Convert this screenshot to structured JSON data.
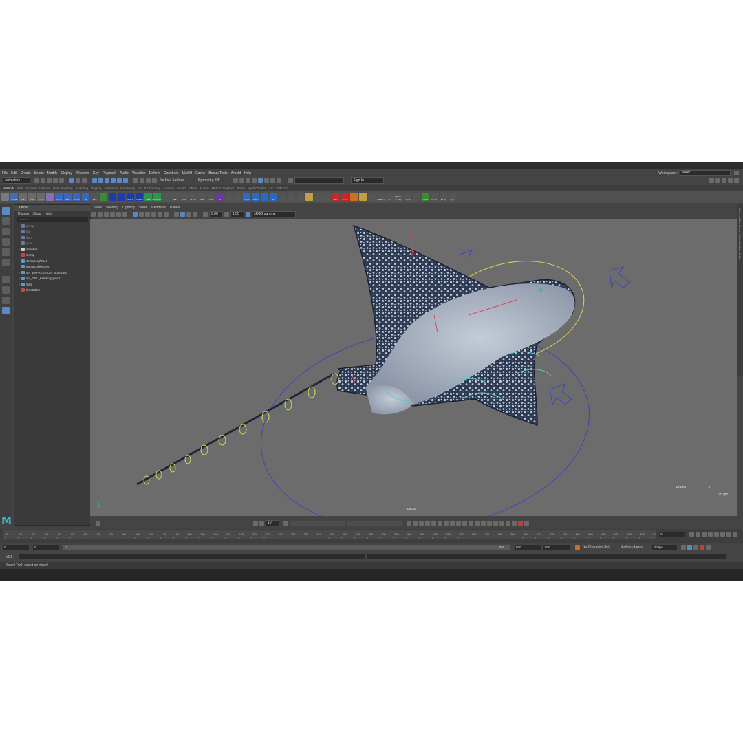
{
  "menus": [
    "File",
    "Edit",
    "Create",
    "Select",
    "Modify",
    "Display",
    "Windows",
    "Key",
    "Playback",
    "Audio",
    "Visualize",
    "Deform",
    "Constrain",
    "MASH",
    "Cache",
    "Bonus Tools",
    "Arnold",
    "Help"
  ],
  "workspace": {
    "label": "Workspace :",
    "value": "Mike*"
  },
  "status": {
    "mode": "Animation",
    "live_surface": "No Live Surface",
    "symmetry": "Symmetry: Off",
    "sign_in": "Sign In"
  },
  "shelf_tabs": [
    "MyWork",
    "Rich",
    "Curves / Surfaces",
    "Poly Modeling",
    "Sculpting",
    "Rigging",
    "Animation",
    "Rendering",
    "FX",
    "FX Caching",
    "Custom",
    "Arnold",
    "Bifrost",
    "MASH",
    "Motion Graphics",
    "XGen",
    "ngSkinTools2",
    "AS",
    "TURTLE"
  ],
  "shelf_icons": [
    {
      "label": "",
      "color": "#7a7a7a"
    },
    {
      "label": "GLOB",
      "color": "#3d6fa8"
    },
    {
      "label": "RT",
      "color": "#6a6a6a"
    },
    {
      "label": "CP",
      "color": "#6a6a6a"
    },
    {
      "label": "sweet",
      "color": "#6a6a6a"
    },
    {
      "label": "",
      "color": "#8a6fb0"
    },
    {
      "label": "Orient",
      "color": "#3966c0"
    },
    {
      "label": "CTRLs",
      "color": "#3966c0"
    },
    {
      "label": "CV>CV",
      "color": "#3966c0"
    },
    {
      "label": "JS",
      "color": "#3966c0"
    },
    {
      "label": "RSc",
      "color": "#555"
    },
    {
      "label": "",
      "color": "#3a8a3a"
    },
    {
      "label": "",
      "color": "#1b3da8"
    },
    {
      "label": "",
      "color": "#1b3da8"
    },
    {
      "label": "P-R-S",
      "color": "#1b3da8"
    },
    {
      "label": "CONST",
      "color": "#1b3da8"
    },
    {
      "label": "SBS",
      "color": "#2a9a4a"
    },
    {
      "label": "Replicates",
      "color": "#2a9a4a"
    },
    {
      "label": "",
      "color": "#555"
    },
    {
      "label": "BT",
      "color": "#555"
    },
    {
      "label": "NR",
      "color": "#555"
    },
    {
      "label": "M.T.R",
      "color": "#555"
    },
    {
      "label": "MAT",
      "color": "#555"
    },
    {
      "label": "Ctrlt",
      "color": "#555"
    },
    {
      "label": "JS",
      "color": "#6a3a9a"
    },
    {
      "label": "",
      "color": "#555"
    },
    {
      "label": "",
      "color": "#555"
    },
    {
      "label": "Graph",
      "color": "#2a6ac0"
    },
    {
      "label": "CySel",
      "color": "#2a6ac0"
    },
    {
      "label": "",
      "color": "#2a6ac0"
    },
    {
      "label": "SE",
      "color": "#2a6ac0"
    },
    {
      "label": "",
      "color": "#555"
    },
    {
      "label": "",
      "color": "#555"
    },
    {
      "label": "",
      "color": "#555"
    },
    {
      "label": "",
      "color": "#c0a040"
    },
    {
      "label": "",
      "color": "#555"
    },
    {
      "label": "",
      "color": "#555"
    },
    {
      "label": "Bus",
      "color": "#c02a2a"
    },
    {
      "label": "Curvy",
      "color": "#c02a2a"
    },
    {
      "label": "",
      "color": "#d07020"
    },
    {
      "label": "",
      "color": "#c0a040"
    },
    {
      "label": "",
      "color": "#555"
    },
    {
      "label": "CR/Seq",
      "color": "#555"
    },
    {
      "label": "Sel",
      "color": "#555"
    },
    {
      "label": "Ribbon ev+dupl",
      "color": "#555"
    },
    {
      "label": "export",
      "color": "#555"
    },
    {
      "label": "",
      "color": "#555"
    },
    {
      "label": "EasiRef",
      "color": "#3a8a3a"
    },
    {
      "label": "Ejects",
      "color": "#555"
    },
    {
      "label": "Bt+ej",
      "color": "#555"
    },
    {
      "label": "Dyn",
      "color": "#555"
    }
  ],
  "outliner": {
    "title": "Outliner",
    "menu": [
      "Display",
      "Show",
      "Help"
    ],
    "search_placeholder": "Search...",
    "items": [
      {
        "label": "persp",
        "dim": true,
        "expand": ""
      },
      {
        "label": "top",
        "dim": true,
        "expand": ""
      },
      {
        "label": "front",
        "dim": true,
        "expand": ""
      },
      {
        "label": "side",
        "dim": true,
        "expand": ""
      },
      {
        "label": "animBot",
        "dim": false,
        "expand": "+"
      },
      {
        "label": "Group",
        "dim": false,
        "expand": "+"
      },
      {
        "label": "defaultLightSet",
        "dim": false,
        "expand": ""
      },
      {
        "label": "defaultObjectSet",
        "dim": false,
        "expand": ""
      },
      {
        "label": "set_EXPRESSION_Spiracles",
        "dim": false,
        "expand": "+"
      },
      {
        "label": "set_GBL_hidePolygons1",
        "dim": false,
        "expand": "+"
      },
      {
        "label": "Sets",
        "dim": false,
        "expand": "+"
      },
      {
        "label": "timeEditor",
        "dim": false,
        "expand": ""
      }
    ]
  },
  "viewport": {
    "menu": [
      "View",
      "Shading",
      "Lighting",
      "Show",
      "Renderer",
      "Panels"
    ],
    "exposure": "0.00",
    "gamma": "1.00",
    "color_space": "sRGB gamma",
    "camera": "persp",
    "frame_label": "Frame:",
    "frame_value": "0",
    "fps": "6.8 fps"
  },
  "side_panel": "Channel Box / Layer Editor   Attribute Editor",
  "bottom_toolbar": {
    "value": "10",
    "small1": "0.5"
  },
  "timeline": {
    "ticks": [
      0,
      10,
      20,
      30,
      40,
      50,
      60,
      70,
      80,
      90,
      100,
      110,
      120,
      130,
      140,
      150,
      160,
      170,
      180,
      190,
      200,
      210,
      220,
      230,
      240,
      250,
      260,
      270,
      280,
      290,
      300,
      310,
      320,
      330,
      340,
      350,
      360,
      370,
      380,
      390,
      400,
      410,
      420,
      430,
      440,
      450,
      460,
      470,
      480,
      490,
      500
    ],
    "current_frame": "0"
  },
  "range": {
    "start": "0",
    "start2": "0",
    "slider_start": "0",
    "slider_end": "500",
    "end": "500",
    "end2": "500",
    "character_set": "No Character Set",
    "anim_layer": "No Anim Layer",
    "fps": "30 fps"
  },
  "command": {
    "mel": "MEL",
    "help": "Select Tool: select an object"
  },
  "colors": {
    "accent": "#5a8bc0",
    "viewport": "#6c6c6c",
    "maya_logo": "#3ab5c6"
  }
}
